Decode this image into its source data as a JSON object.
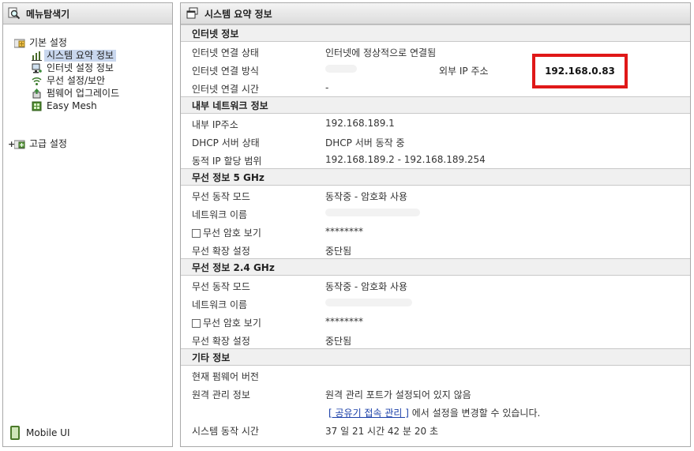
{
  "left_panel": {
    "title": "메뉴탐색기",
    "tree": {
      "basic_label": "기본 설정",
      "items": [
        {
          "label": "시스템 요약 정보",
          "selected": true,
          "icon": "chart-icon"
        },
        {
          "label": "인터넷 설정 정보",
          "icon": "network-icon"
        },
        {
          "label": "무선 설정/보안",
          "icon": "wifi-icon"
        },
        {
          "label": "펌웨어 업그레이드",
          "icon": "upgrade-icon"
        },
        {
          "label": "Easy Mesh",
          "icon": "mesh-icon"
        }
      ],
      "advanced_label": "고급 설정"
    },
    "mobile_ui": "Mobile UI"
  },
  "right_panel": {
    "title": "시스템 요약 정보",
    "internet": {
      "heading": "인터넷 정보",
      "conn_status_k": "인터넷 연결 상태",
      "conn_status_v": "인터넷에 정상적으로 연결됨",
      "conn_method_k": "인터넷 연결 방식",
      "ext_ip_k": "외부 IP 주소",
      "ext_ip_v": "192.168.0.83",
      "conn_time_k": "인터넷 연결 시간",
      "conn_time_v": "-"
    },
    "lan": {
      "heading": "내부 네트워크 정보",
      "ip_k": "내부 IP주소",
      "ip_v": "192.168.189.1",
      "dhcp_k": "DHCP 서버 상태",
      "dhcp_v": "DHCP 서버 동작 중",
      "range_k": "동적 IP 할당 범위",
      "range_v": "192.168.189.2 - 192.168.189.254"
    },
    "wifi5": {
      "heading": "무선 정보 5 GHz",
      "mode_k": "무선 동작 모드",
      "mode_v": "동작중 - 암호화 사용",
      "name_k": "네트워크 이름",
      "pw_k": "무선 암호 보기",
      "pw_v": "********",
      "ext_k": "무선 확장 설정",
      "ext_v": "중단됨"
    },
    "wifi24": {
      "heading": "무선 정보 2.4 GHz",
      "mode_k": "무선 동작 모드",
      "mode_v": "동작중 - 암호화 사용",
      "name_k": "네트워크 이름",
      "pw_k": "무선 암호 보기",
      "pw_v": "********",
      "ext_k": "무선 확장 설정",
      "ext_v": "중단됨"
    },
    "etc": {
      "heading": "기타 정보",
      "fw_k": "현재 펌웨어 버전",
      "remote_k": "원격 관리 정보",
      "remote_v": "원격 관리 포트가 설정되어 있지 않음",
      "remote_link": "[ 공유기 접속 관리 ]",
      "remote_suffix": " 에서 설정을 변경할 수 있습니다.",
      "uptime_k": "시스템 동작 시간",
      "uptime_v": "37 일 21 시간 42 분 20 초"
    }
  },
  "colors": {
    "highlight_box": "#e01818",
    "selected_bg": "#c9d7ee",
    "link": "#1a3fa8"
  }
}
